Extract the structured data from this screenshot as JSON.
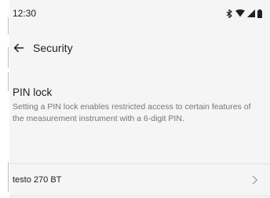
{
  "status_bar": {
    "time": "12:30",
    "icons": [
      "bluetooth-icon",
      "wifi-icon",
      "signal-icon",
      "battery-icon"
    ]
  },
  "app_bar": {
    "title": "Security",
    "back_icon": "arrow-left-icon"
  },
  "pin_section": {
    "title": "PIN lock",
    "description": "Setting a PIN lock enables restricted access to certain features of the measurement instrument with a 6-digit PIN."
  },
  "device": {
    "name": "testo 270 BT",
    "icon": "chevron-right-icon"
  },
  "colors": {
    "background": "#f5f5f5",
    "text": "#212121",
    "secondary_text": "#757575"
  }
}
